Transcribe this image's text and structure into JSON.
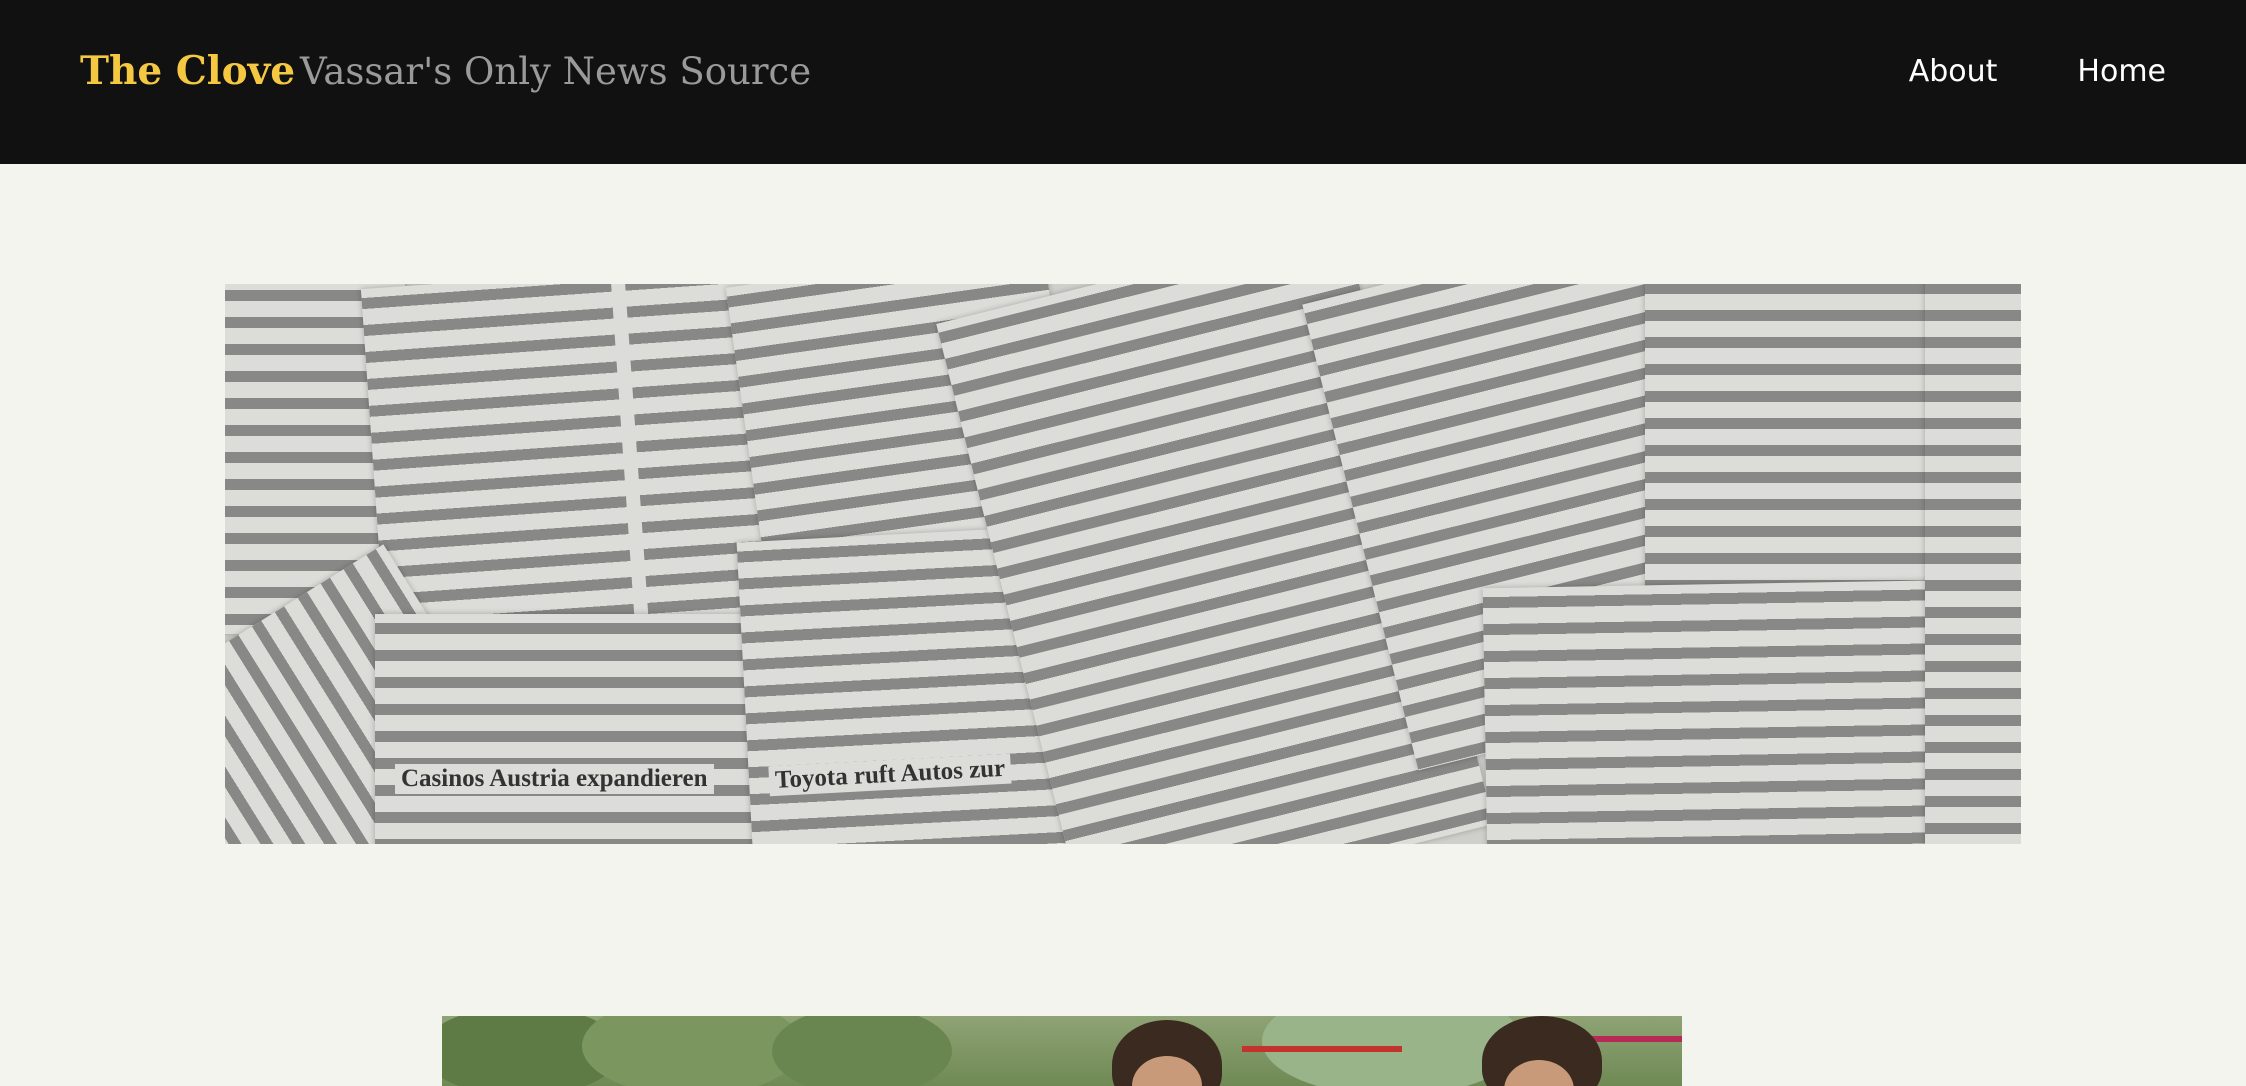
{
  "header": {
    "site_title": "The Clove",
    "tagline": "Vassar's Only News Source",
    "nav": [
      "About",
      "Home"
    ]
  },
  "banner": {
    "description_icon": "newspaper-image",
    "headlines": [
      "Casinos Austria expandieren",
      "Toyota ruft Autos zur"
    ]
  },
  "colors": {
    "header_bg": "#111111",
    "title": "#f5c842",
    "tagline": "#9a9a9a",
    "nav_text": "#ffffff",
    "page_bg": "#f4f4ee"
  }
}
